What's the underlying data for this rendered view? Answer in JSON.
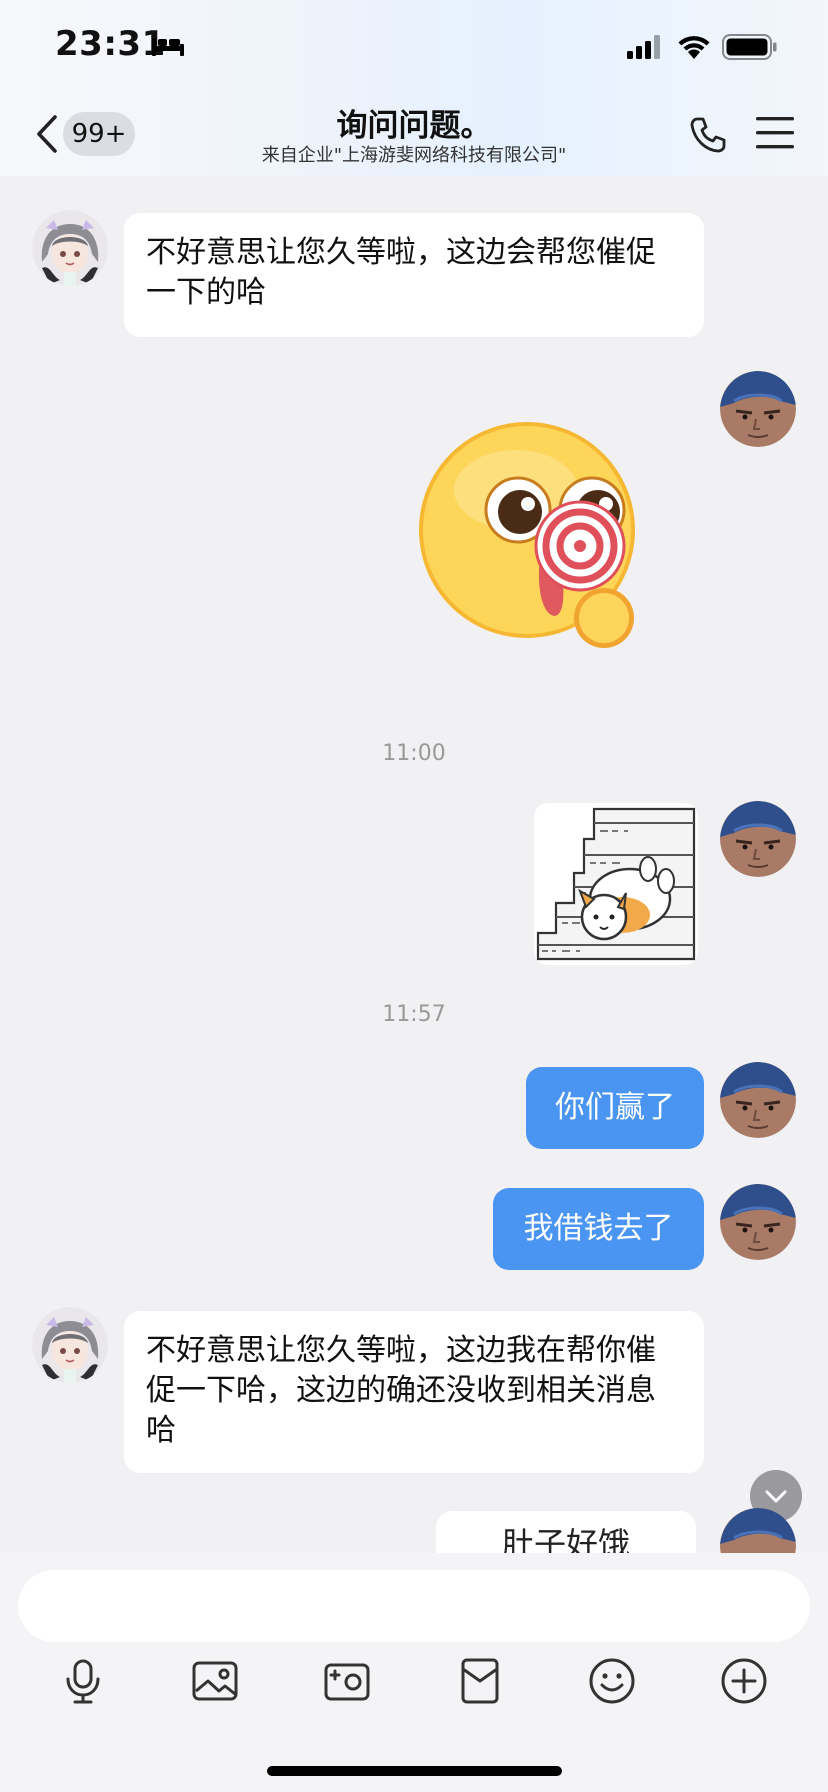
{
  "status_bar": {
    "time": "23:31",
    "icons": [
      "bed-icon",
      "signal-icon",
      "wifi-icon",
      "battery-icon"
    ]
  },
  "header": {
    "back_icon": "chevron-left-icon",
    "unread_badge": "99+",
    "title": "询问问题。",
    "subtitle": "来自企业\"上海游斐网络科技有限公司\"",
    "actions": [
      "phone-icon",
      "menu-icon"
    ]
  },
  "messages": [
    {
      "side": "left",
      "type": "text",
      "text": "不好意思让您久等啦，这边会帮您催促一下的哈"
    },
    {
      "side": "right",
      "type": "sticker",
      "sticker": "lollipop-emoji-sticker"
    },
    {
      "type": "timestamp",
      "text": "11:00"
    },
    {
      "side": "right",
      "type": "sticker",
      "sticker": "corgi-on-stairs-sticker"
    },
    {
      "type": "timestamp",
      "text": "11:57"
    },
    {
      "side": "right",
      "type": "text",
      "text": "你们赢了"
    },
    {
      "side": "right",
      "type": "text",
      "text": "我借钱去了"
    },
    {
      "side": "left",
      "type": "text",
      "text": "不好意思让您久等啦，这边我在帮你催促一下哈，这边的确还没收到相关消息哈"
    },
    {
      "side": "right",
      "type": "sticker",
      "text": "肚子好饿"
    }
  ],
  "composer": {
    "input_value": "",
    "tools": [
      "microphone-icon",
      "image-icon",
      "camera-icon",
      "red-packet-icon",
      "emoji-icon",
      "plus-icon"
    ]
  },
  "colors": {
    "accent_blue": "#4a95f1",
    "chat_background": "#f1f1f3",
    "bubble_white": "#ffffff"
  }
}
